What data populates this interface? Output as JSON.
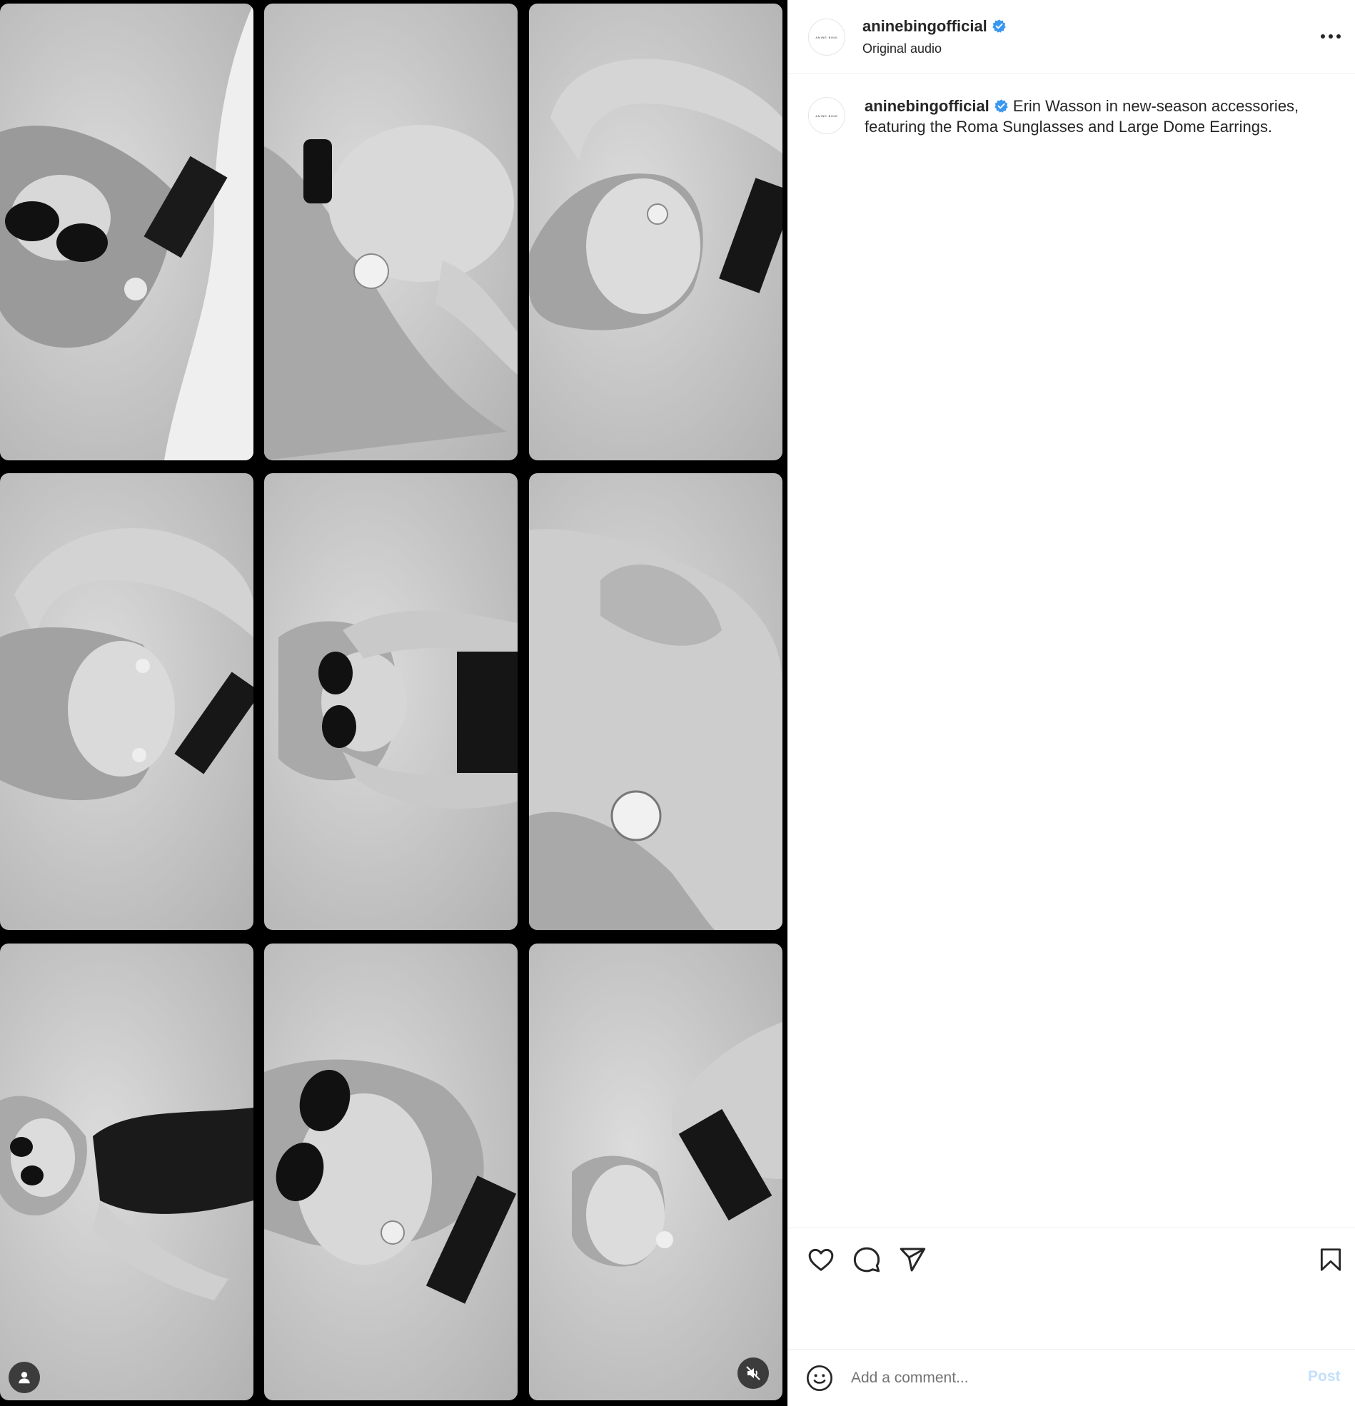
{
  "post": {
    "username": "aninebingofficial",
    "verified": true,
    "audio_label": "Original audio",
    "avatar_text": "ANINE BING",
    "caption": "Erin Wasson in new-season accessories, featuring the Roma Sunglasses and Large Dome Earrings."
  },
  "media": {
    "tiles": [
      {
        "row": 1,
        "col": 1,
        "subject": "photo-sunglasses-side-profile"
      },
      {
        "row": 1,
        "col": 2,
        "subject": "photo-dome-earring-sunglasses"
      },
      {
        "row": 1,
        "col": 3,
        "subject": "photo-arm-raised-earring"
      },
      {
        "row": 2,
        "col": 1,
        "subject": "photo-arm-tattoos-portrait"
      },
      {
        "row": 2,
        "col": 2,
        "subject": "photo-hands-sunglasses"
      },
      {
        "row": 2,
        "col": 3,
        "subject": "photo-closeup-dome-earring"
      },
      {
        "row": 3,
        "col": 1,
        "subject": "photo-reclining-sunglasses"
      },
      {
        "row": 3,
        "col": 2,
        "subject": "photo-sunglasses-earring-closeup"
      },
      {
        "row": 3,
        "col": 3,
        "subject": "photo-leaning-portrait"
      }
    ],
    "muted": true
  },
  "comment": {
    "placeholder": "Add a comment...",
    "post_label": "Post"
  },
  "colors": {
    "verified_badge": "#3897f0",
    "post_disabled": "#c3dffb",
    "divider": "#efefef"
  }
}
